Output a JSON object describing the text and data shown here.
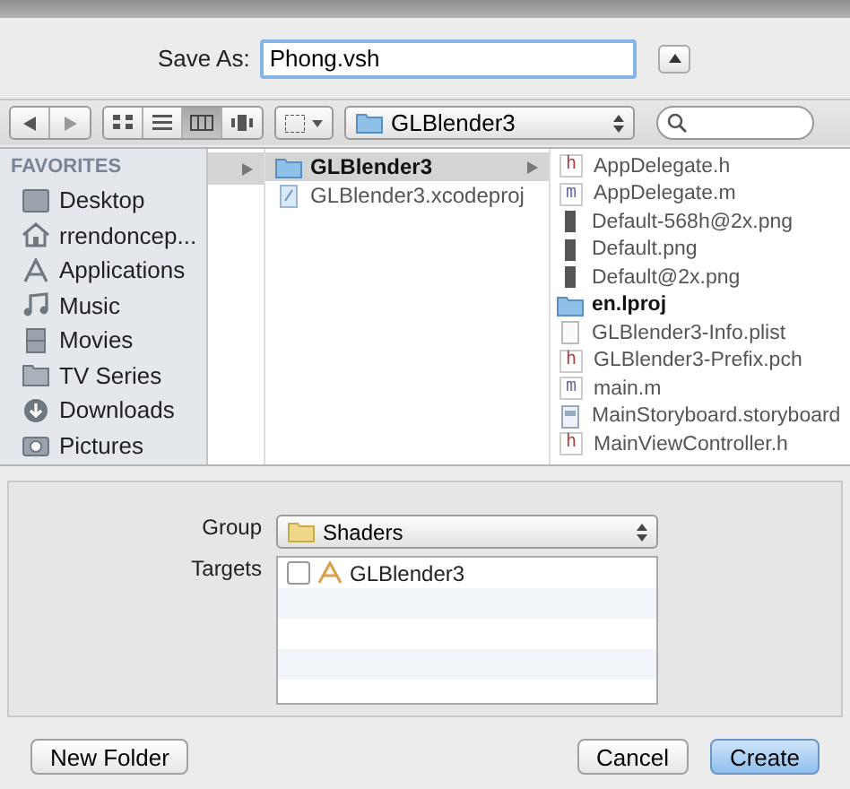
{
  "save_as": {
    "label": "Save As:",
    "value": "Phong.vsh",
    "expanded": false
  },
  "toolbar": {
    "view_modes": [
      {
        "kind": "icons",
        "selected": false
      },
      {
        "kind": "list",
        "selected": false
      },
      {
        "kind": "columns",
        "selected": true
      },
      {
        "kind": "coverflow",
        "selected": false
      }
    ],
    "location": "GLBlender3"
  },
  "sidebar": {
    "heading": "FAVORITES",
    "items": [
      {
        "label": "Desktop",
        "kind": "desktop"
      },
      {
        "label": "rrendoncep...",
        "kind": "home"
      },
      {
        "label": "Applications",
        "kind": "apps"
      },
      {
        "label": "Music",
        "kind": "music"
      },
      {
        "label": "Movies",
        "kind": "movies"
      },
      {
        "label": "TV Series",
        "kind": "folder"
      },
      {
        "label": "Downloads",
        "kind": "downloads"
      },
      {
        "label": "Pictures",
        "kind": "pictures"
      }
    ]
  },
  "column_1": {
    "selected": true
  },
  "column_2": [
    {
      "name": "GLBlender3",
      "kind": "folder",
      "selected": true,
      "expandable": true
    },
    {
      "name": "GLBlender3.xcodeproj",
      "kind": "project",
      "selected": false,
      "expandable": false
    }
  ],
  "column_3": [
    {
      "name": "AppDelegate.h",
      "kind": "code",
      "badge": "h"
    },
    {
      "name": "AppDelegate.m",
      "kind": "code",
      "badge": "m"
    },
    {
      "name": "Default-568h@2x.png",
      "kind": "image"
    },
    {
      "name": "Default.png",
      "kind": "image"
    },
    {
      "name": "Default@2x.png",
      "kind": "image"
    },
    {
      "name": "en.lproj",
      "kind": "folder"
    },
    {
      "name": "GLBlender3-Info.plist",
      "kind": "plist"
    },
    {
      "name": "GLBlender3-Prefix.pch",
      "kind": "code",
      "badge": "h"
    },
    {
      "name": "main.m",
      "kind": "code",
      "badge": "m"
    },
    {
      "name": "MainStoryboard.storyboard",
      "kind": "storyboard"
    },
    {
      "name": "MainViewController.h",
      "kind": "code",
      "badge": "h"
    }
  ],
  "options": {
    "group_label": "Group",
    "group": "Shaders",
    "targets_label": "Targets",
    "targets": [
      {
        "name": "GLBlender3",
        "checked": false
      }
    ]
  },
  "buttons": {
    "new_folder": "New Folder",
    "cancel": "Cancel",
    "create": "Create"
  }
}
